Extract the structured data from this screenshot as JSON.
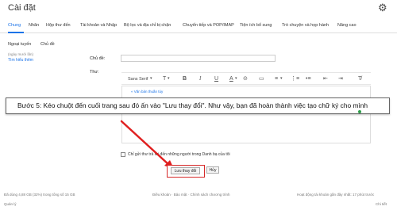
{
  "header": {
    "title": "Cài đặt"
  },
  "tabs": [
    "Chung",
    "Nhãn",
    "Hộp thư đến",
    "Tài khoản và Nhập",
    "Bộ lọc và địa chỉ bị chặn",
    "Chuyển tiếp và POP/IMAP",
    "Tiện ích bổ sung",
    "Trò chuyện và họp hành",
    "Nâng cao"
  ],
  "subtabs": [
    "Ngoại tuyến",
    "Chủ đề"
  ],
  "sidebar": {
    "small_text": "(ngày mười lần)",
    "learn_more": "Tìm hiểu thêm"
  },
  "form": {
    "subject_label": "Chủ đề:",
    "body_label": "Thư:",
    "font_name": "Sans Serif"
  },
  "toolbar": {
    "bold": "B",
    "italic": "I",
    "underline": "U",
    "text_color": "A",
    "undo": "↶",
    "redo": "↷",
    "size": "T",
    "link": "⊝",
    "image": "▭",
    "align": "≡",
    "numbered": "⋮≡",
    "bulleted": "•≡",
    "indent_less": "⇤",
    "indent_more": "⇥",
    "clear": "T̸"
  },
  "editor": {
    "link_text": "« Văn bản thuần túy"
  },
  "caption": {
    "text": "Bước 5: Kéo chuột đến cuối trang sau đó ấn vào \"Lưu thay đổi\". Như vậy, bạn đã hoàn thành việc tạo chữ ký cho mình"
  },
  "contacts_checkbox": {
    "label": "Chỉ gửi thư trả lời đến những người trong Danh bạ của tôi"
  },
  "actions": {
    "save": "Lưu thay đổi",
    "cancel": "Hủy"
  },
  "footer": {
    "storage": "Đã dùng 4,88 GB (32%) trong tổng số 15 GB",
    "manage": "Quản lý",
    "terms": "Điều khoản · Bảo mật · Chính sách chương trình",
    "activity": "Hoạt động tài khoản gần đây nhất: 17 phút trước",
    "details": "Chi tiết"
  },
  "colors": {
    "accent": "#1a73e8",
    "highlight": "#d62828",
    "arrow": "#e02020"
  }
}
